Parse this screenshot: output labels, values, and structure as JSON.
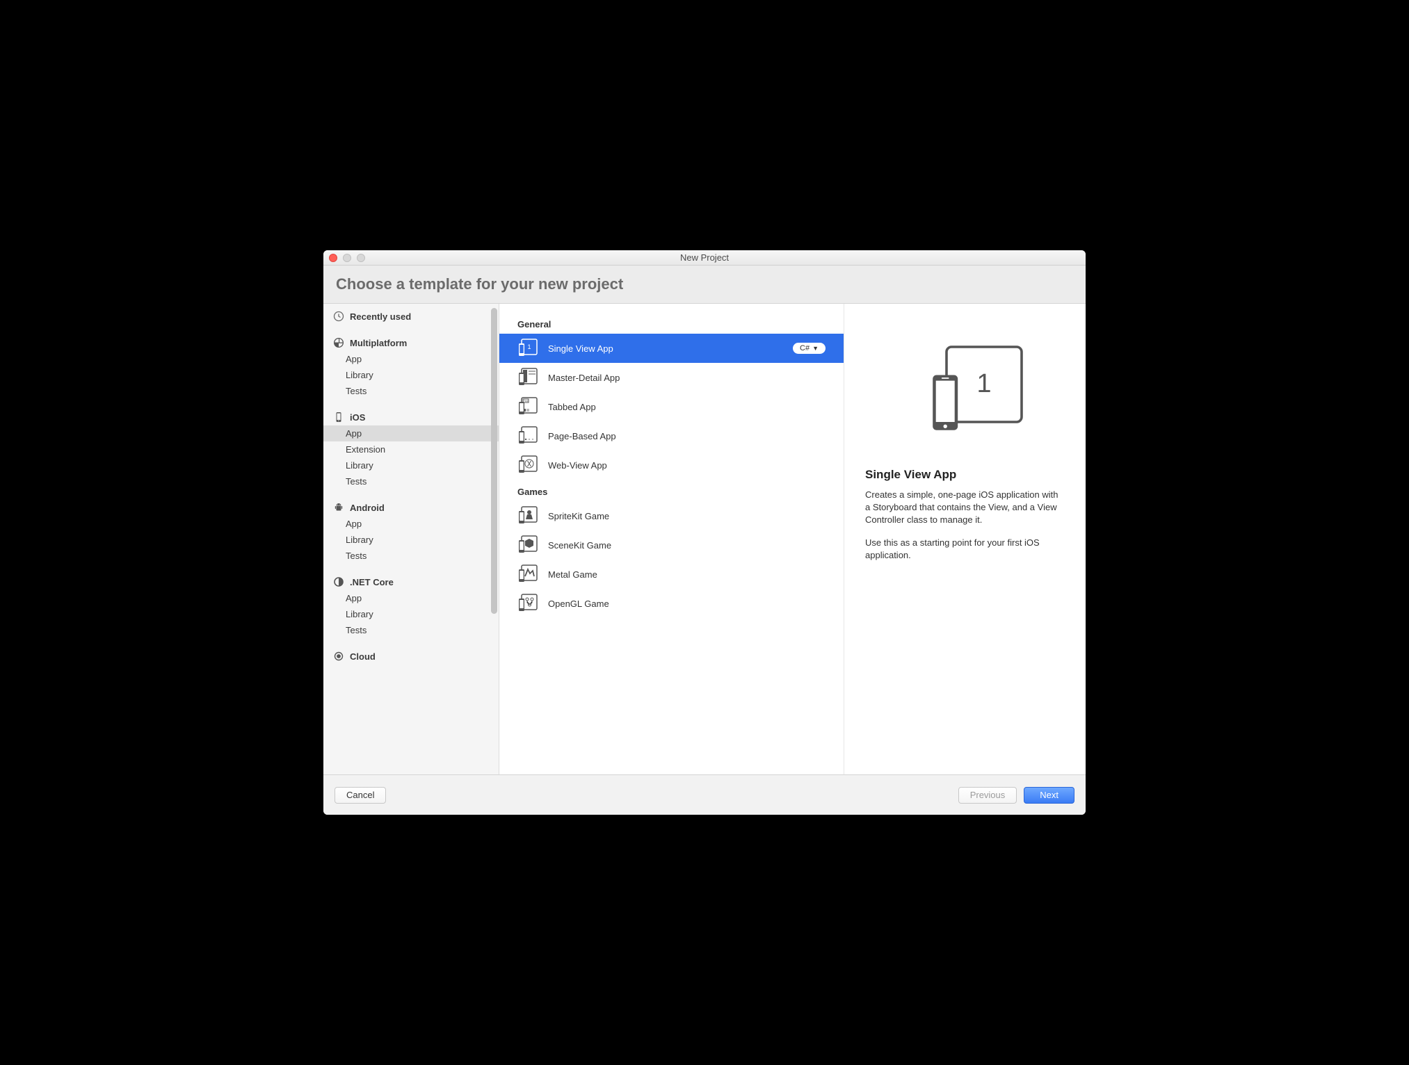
{
  "window": {
    "title": "New Project"
  },
  "header": {
    "heading": "Choose a template for your new project"
  },
  "sidebar": {
    "recent_label": "Recently used",
    "categories": [
      {
        "name": "Multiplatform",
        "icon": "multiplatform",
        "items": [
          {
            "label": "App"
          },
          {
            "label": "Library"
          },
          {
            "label": "Tests"
          }
        ]
      },
      {
        "name": "iOS",
        "icon": "ios",
        "items": [
          {
            "label": "App",
            "selected": true
          },
          {
            "label": "Extension"
          },
          {
            "label": "Library"
          },
          {
            "label": "Tests"
          }
        ]
      },
      {
        "name": "Android",
        "icon": "android",
        "items": [
          {
            "label": "App"
          },
          {
            "label": "Library"
          },
          {
            "label": "Tests"
          }
        ]
      },
      {
        "name": ".NET Core",
        "icon": "netcore",
        "items": [
          {
            "label": "App"
          },
          {
            "label": "Library"
          },
          {
            "label": "Tests"
          }
        ]
      },
      {
        "name": "Cloud",
        "icon": "cloud",
        "items": []
      }
    ]
  },
  "templates": {
    "groups": [
      {
        "header": "General",
        "items": [
          {
            "label": "Single View App",
            "selected": true,
            "lang": "C#"
          },
          {
            "label": "Master-Detail App"
          },
          {
            "label": "Tabbed App"
          },
          {
            "label": "Page-Based App"
          },
          {
            "label": "Web-View App"
          }
        ]
      },
      {
        "header": "Games",
        "items": [
          {
            "label": "SpriteKit Game"
          },
          {
            "label": "SceneKit Game"
          },
          {
            "label": "Metal Game"
          },
          {
            "label": "OpenGL Game"
          }
        ]
      }
    ]
  },
  "detail": {
    "title": "Single View App",
    "p1": "Creates a simple, one-page iOS application with a Storyboard that contains the View, and a View Controller class to manage it.",
    "p2": "Use this as a starting point for your first iOS application."
  },
  "footer": {
    "cancel": "Cancel",
    "previous": "Previous",
    "next": "Next"
  }
}
